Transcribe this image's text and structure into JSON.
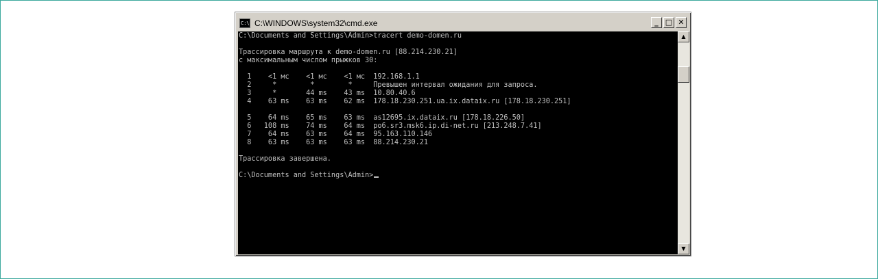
{
  "window": {
    "title": "C:\\WINDOWS\\system32\\cmd.exe",
    "icon_label": "C:\\",
    "icon": "cmd-console-icon",
    "buttons": {
      "minimize_glyph": "_",
      "maximize_glyph": "□",
      "close_glyph": "✕"
    }
  },
  "console": {
    "lines": [
      "C:\\Documents and Settings\\Admin>tracert demo-domen.ru",
      "",
      "Трассировка маршрута к demo-domen.ru [88.214.230.21]",
      "с максимальным числом прыжков 30:",
      "",
      "  1    <1 мс    <1 мс    <1 мс  192.168.1.1",
      "  2     *        *        *     Превышен интервал ожидания для запроса.",
      "  3     *       44 ms    43 ms  10.80.40.6",
      "  4    63 ms    63 ms    62 ms  178.18.230.251.ua.ix.dataix.ru [178.18.230.251]",
      "",
      "  5    64 ms    65 ms    63 ms  as12695.ix.dataix.ru [178.18.226.50]",
      "  6   108 ms    74 ms    64 ms  po6.sr3.msk6.ip.di-net.ru [213.248.7.41]",
      "  7    64 ms    63 ms    64 ms  95.163.110.146",
      "  8    63 ms    63 ms    63 ms  88.214.230.21",
      "",
      "Трассировка завершена.",
      "",
      "C:\\Documents and Settings\\Admin>"
    ]
  },
  "scrollbar": {
    "up_glyph": "▲",
    "down_glyph": "▼"
  },
  "colors": {
    "console_bg": "#000000",
    "console_text": "#c0c0c0",
    "window_chrome": "#d4d0c8"
  }
}
